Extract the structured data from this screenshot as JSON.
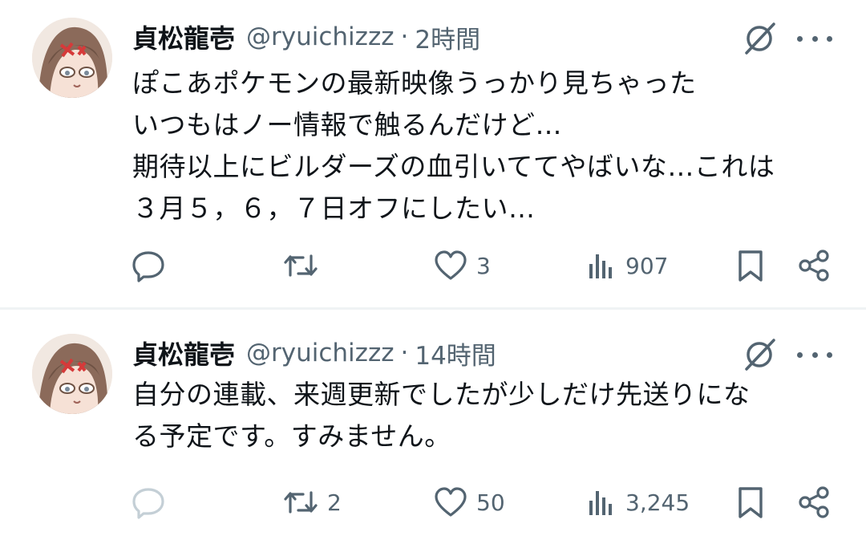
{
  "tweets": [
    {
      "author_name": "貞松龍壱",
      "handle": "@ryuichizzz",
      "separator": "·",
      "time": "2時間",
      "text": "ぽこあポケモンの最新映像うっかり見ちゃった\nいつもはノー情報で触るんだけど…\n期待以上にビルダーズの血引いててやばいな…これは\n３月５，６，７日オフにしたい…",
      "reply_count": "",
      "retweet_count": "",
      "like_count": "3",
      "view_count": "907",
      "reply_icon_color": "#536471"
    },
    {
      "author_name": "貞松龍壱",
      "handle": "@ryuichizzz",
      "separator": "·",
      "time": "14時間",
      "text": "自分の連載、来週更新でしたが少しだけ先送りにな\nる予定です。すみません。",
      "reply_count": "",
      "retweet_count": "2",
      "like_count": "50",
      "view_count": "3,245",
      "reply_icon_color": "#c4cfd6"
    }
  ],
  "icons": {
    "grok": "grok-icon",
    "more": "more-icon",
    "reply": "reply-icon",
    "retweet": "retweet-icon",
    "like": "heart-icon",
    "views": "views-icon",
    "bookmark": "bookmark-icon",
    "share": "share-icon"
  },
  "colors": {
    "text": "#0f1419",
    "secondary": "#536471",
    "divider": "#eff3f4"
  }
}
